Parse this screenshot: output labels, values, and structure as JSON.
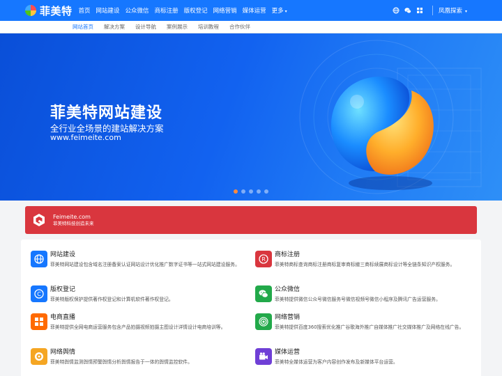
{
  "header": {
    "logo_text": "菲美特",
    "nav": [
      {
        "label": "首页"
      },
      {
        "label": "网站建设"
      },
      {
        "label": "公众微信"
      },
      {
        "label": "商标注册"
      },
      {
        "label": "版权登记"
      },
      {
        "label": "网络营销"
      },
      {
        "label": "媒体运营"
      },
      {
        "label": "更多"
      }
    ],
    "more_caret": "▾",
    "right_icons": [
      "globe-icon",
      "wechat-icon",
      "grid-icon"
    ],
    "explore_label": "凤凰探索",
    "explore_caret": "▾"
  },
  "subnav": {
    "items": [
      {
        "label": "网站首页",
        "active": true
      },
      {
        "label": "解决方案"
      },
      {
        "label": "设计导航"
      },
      {
        "label": "案例展示"
      },
      {
        "label": "培训教程"
      },
      {
        "label": "合作伙伴"
      }
    ]
  },
  "banner": {
    "title": "菲美特网站建设",
    "subtitle": "全行业全场景的建站解决方案",
    "url": "www.feimeite.com",
    "slides": 5,
    "active_slide": 0
  },
  "notice": {
    "title": "Feimeite.com",
    "subtitle": "菲美特科技创造未来",
    "color": "#d9363e"
  },
  "services": [
    {
      "title": "网站建设",
      "desc": "菲美特网站建设包含域名注册备案认证网站设计优化推广数字证书等一站式网站建设服务。",
      "icon": "globe-icon",
      "color": "#1677ff"
    },
    {
      "title": "商标注册",
      "desc": "菲美特商标查询商标注册商标复审商标撤三商标续展商标设计等全链条知识产权服务。",
      "icon": "registered-icon",
      "color": "#d9363e"
    },
    {
      "title": "版权登记",
      "desc": "菲美特版权保护提供著作权登记和计算机软件著作权登记。",
      "icon": "copyright-icon",
      "color": "#1677ff"
    },
    {
      "title": "公众微信",
      "desc": "菲美特提供微信公众号微信服务号微信视频号微信小程序及腾讯广告运营服务。",
      "icon": "wechat-icon",
      "color": "#22a94a"
    },
    {
      "title": "电商直播",
      "desc": "菲美特提供全网电商运营服务包含产品拍摄视频拍摄主图设计详情设计电商培训等。",
      "icon": "shop-icon",
      "color": "#ff6a00"
    },
    {
      "title": "网络营销",
      "desc": "菲美特提供百度360搜索优化推广谷歌海外推广自媒体推广社交媒体推广及网络在线广告。",
      "icon": "signal-icon",
      "color": "#22a94a"
    },
    {
      "title": "网络舆情",
      "desc": "菲美特舆情监测舆情预警舆情分析舆情报告于一体的舆情监控软件。",
      "icon": "target-icon",
      "color": "#f5a623"
    },
    {
      "title": "媒体运营",
      "desc": "菲美特全媒体运营为客户内容创作发布及新媒体平台运营。",
      "icon": "video-icon",
      "color": "#6f3fd6"
    }
  ]
}
